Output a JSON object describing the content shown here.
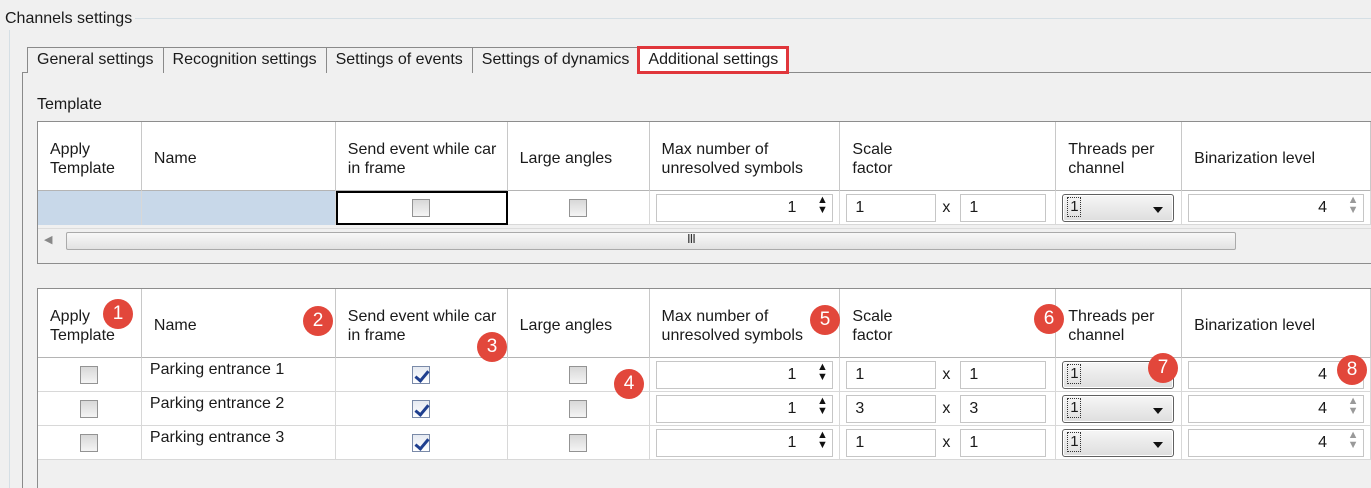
{
  "group": {
    "title": "Channels settings"
  },
  "tabs": [
    {
      "label": "General settings",
      "active": false
    },
    {
      "label": "Recognition settings",
      "active": false
    },
    {
      "label": "Settings of events",
      "active": false
    },
    {
      "label": "Settings of dynamics",
      "active": false
    },
    {
      "label": "Additional settings",
      "active": true
    }
  ],
  "template_section": {
    "label": "Template"
  },
  "columns": {
    "apply_template": "Apply Template",
    "name": "Name",
    "send_event": "Send event while car in frame",
    "large_angles": "Large angles",
    "max_unresolved": "Max number of unresolved symbols",
    "scale_factor": "Scale factor",
    "threads": "Threads per channel",
    "binarization": "Binarization level"
  },
  "template_row": {
    "send_event": false,
    "large_angles": false,
    "max_unresolved": "1",
    "scale_x": "1",
    "scale_sep": "x",
    "scale_y": "1",
    "threads": "1",
    "binarization": "4"
  },
  "channels": [
    {
      "apply_template": false,
      "name": "Parking entrance 1",
      "send_event": true,
      "large_angles": false,
      "max_unresolved": "1",
      "scale_x": "1",
      "scale_y": "1",
      "threads": "1",
      "binarization": "4"
    },
    {
      "apply_template": false,
      "name": "Parking entrance 2",
      "send_event": true,
      "large_angles": false,
      "max_unresolved": "1",
      "scale_x": "3",
      "scale_y": "3",
      "threads": "1",
      "binarization": "4"
    },
    {
      "apply_template": false,
      "name": "Parking entrance 3",
      "send_event": true,
      "large_angles": false,
      "max_unresolved": "1",
      "scale_x": "1",
      "scale_y": "1",
      "threads": "1",
      "binarization": "4"
    }
  ],
  "scrollbar": {
    "grip": "III"
  },
  "callouts": [
    "1",
    "2",
    "3",
    "4",
    "5",
    "6",
    "7",
    "8"
  ],
  "colors": {
    "callout": "#e2473b",
    "active_tab_outline": "#e0363b",
    "template_cell": "#c8d8e9"
  }
}
